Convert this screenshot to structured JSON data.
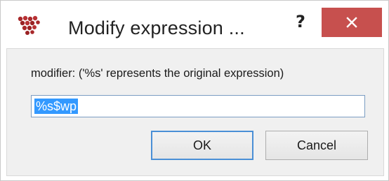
{
  "window": {
    "title": "Modify expression ...",
    "help_label": "?",
    "close_icon": "close-icon",
    "app_icon": "grape-cluster-icon",
    "colors": {
      "close_button": "#c7504e",
      "selection": "#3399ff",
      "focus_border": "#4a8fd6"
    }
  },
  "form": {
    "label": "modifier: ('%s' represents the original expression)",
    "input_value": "%s$wp"
  },
  "buttons": {
    "ok_label": "OK",
    "cancel_label": "Cancel"
  }
}
